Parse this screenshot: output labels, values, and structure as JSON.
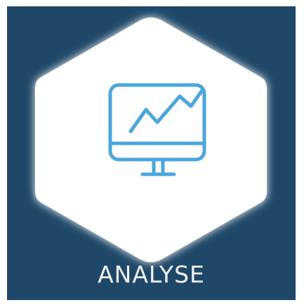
{
  "tile": {
    "label": "ANALYSE",
    "background_color": "#1f4868",
    "hexagon_color": "#ffffff",
    "icon": "monitor-chart-icon",
    "icon_color": "#4aa6dc"
  }
}
